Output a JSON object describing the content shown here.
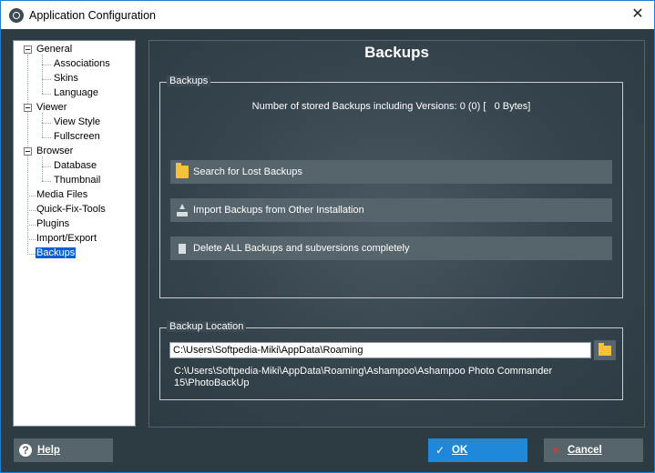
{
  "window": {
    "title": "Application Configuration"
  },
  "tree": [
    {
      "label": "General",
      "level": 0,
      "expandable": true
    },
    {
      "label": "Associations",
      "level": 1
    },
    {
      "label": "Skins",
      "level": 1
    },
    {
      "label": "Language",
      "level": 1
    },
    {
      "label": "Viewer",
      "level": 0,
      "expandable": true
    },
    {
      "label": "View Style",
      "level": 1
    },
    {
      "label": "Fullscreen",
      "level": 1
    },
    {
      "label": "Browser",
      "level": 0,
      "expandable": true
    },
    {
      "label": "Database",
      "level": 1
    },
    {
      "label": "Thumbnail",
      "level": 1
    },
    {
      "label": "Media Files",
      "level": 0
    },
    {
      "label": "Quick-Fix-Tools",
      "level": 0
    },
    {
      "label": "Plugins",
      "level": 0
    },
    {
      "label": "Import/Export",
      "level": 0
    },
    {
      "label": "Backups",
      "level": 0,
      "selected": true
    }
  ],
  "page": {
    "title": "Backups",
    "backups_group": {
      "label": "Backups",
      "stats": "Number of stored Backups including Versions: 0 (0) [   0 Bytes]",
      "search_label": "Search for Lost Backups",
      "import_label": "Import Backups from Other Installation",
      "delete_label": "Delete ALL Backups and subversions completely"
    },
    "location_group": {
      "label": "Backup Location",
      "path_value": "C:\\Users\\Softpedia-Miki\\AppData\\Roaming",
      "full_path": "C:\\Users\\Softpedia-Miki\\AppData\\Roaming\\Ashampoo\\Ashampoo Photo Commander 15\\PhotoBackUp"
    }
  },
  "buttons": {
    "help": "Help",
    "ok": "OK",
    "cancel": "Cancel"
  }
}
